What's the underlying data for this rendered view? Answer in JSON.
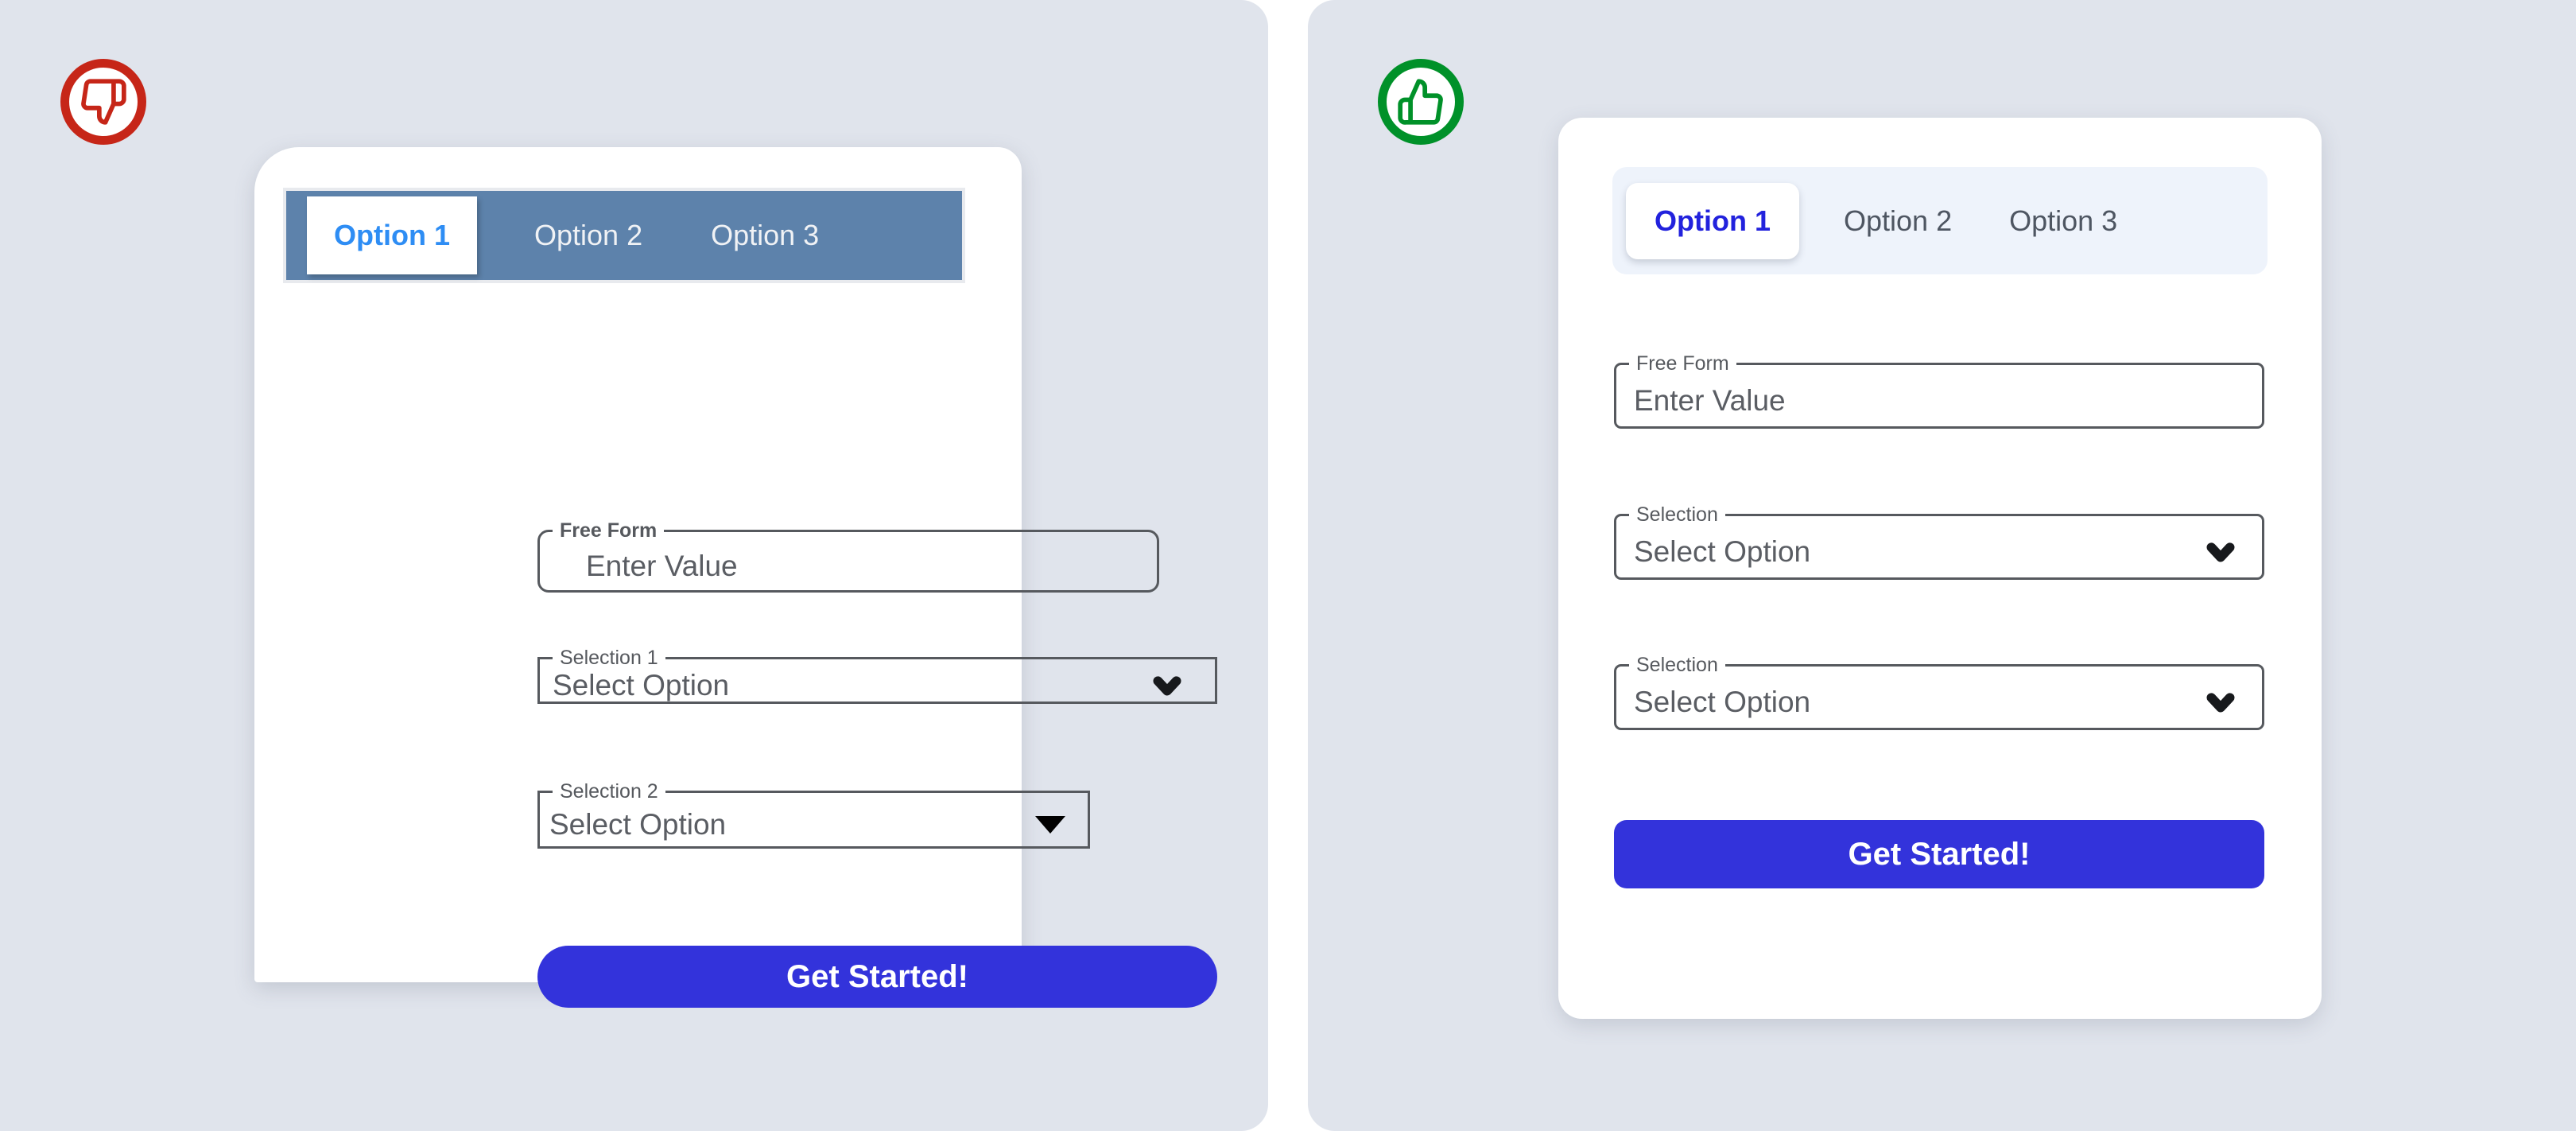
{
  "colors": {
    "panel_background": "#e0e4ec",
    "page_background": "#ffffff",
    "card_background": "#ffffff",
    "bad_badge_ring": "#c62618",
    "good_badge_ring": "#009129",
    "bad_tabbar_background": "#5d82ab",
    "bad_active_tab_text": "#2e8df4",
    "bad_inactive_tab_text": "#f0f2f5",
    "good_tabbar_background": "#eef3fb",
    "good_active_tab_text": "#2222dd",
    "good_inactive_tab_text": "#4e5662",
    "field_border": "#56595e",
    "field_text": "#5a5d63",
    "cta_background": "#3333db",
    "cta_text": "#ffffff"
  },
  "bad": {
    "badge_icon": "thumbs-down-icon",
    "tabs": [
      {
        "label": "Option 1",
        "active": true
      },
      {
        "label": "Option 2",
        "active": false
      },
      {
        "label": "Option 3",
        "active": false
      }
    ],
    "fields": [
      {
        "legend": "Free Form",
        "value": "Enter Value",
        "control": "text-input"
      },
      {
        "legend": "Selection 1",
        "value": "Select Option",
        "control": "select-chevron"
      },
      {
        "legend": "Selection 2",
        "value": "Select Option",
        "control": "select-triangle"
      }
    ],
    "cta_label": "Get Started!"
  },
  "good": {
    "badge_icon": "thumbs-up-icon",
    "tabs": [
      {
        "label": "Option 1",
        "active": true
      },
      {
        "label": "Option 2",
        "active": false
      },
      {
        "label": "Option 3",
        "active": false
      }
    ],
    "fields": [
      {
        "legend": "Free Form",
        "value": "Enter Value",
        "control": "text-input"
      },
      {
        "legend": "Selection",
        "value": "Select Option",
        "control": "select-chevron"
      },
      {
        "legend": "Selection",
        "value": "Select Option",
        "control": "select-chevron"
      }
    ],
    "cta_label": "Get Started!"
  }
}
